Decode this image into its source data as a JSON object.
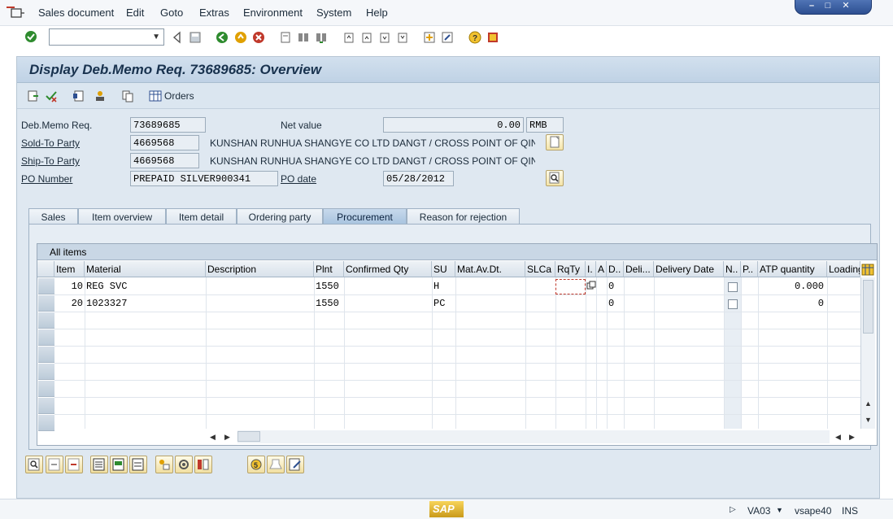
{
  "menubar": {
    "items": [
      "Sales document",
      "Edit",
      "Goto",
      "Extras",
      "Environment",
      "System",
      "Help"
    ]
  },
  "title": "Display Deb.Memo Req. 73689685: Overview",
  "app_toolbar": {
    "orders_label": "Orders"
  },
  "header": {
    "debmemo": {
      "label": "Deb.Memo Req.",
      "value": "73689685"
    },
    "net_value": {
      "label": "Net value",
      "value": "0.00",
      "currency": "RMB"
    },
    "sold_to": {
      "label": "Sold-To Party",
      "value": "4669568",
      "name": "KUNSHAN RUNHUA SHANGYE CO LTD DANGT / CROSS POINT OF QIN..."
    },
    "ship_to": {
      "label": "Ship-To Party",
      "value": "4669568",
      "name": "KUNSHAN RUNHUA SHANGYE CO LTD DANGT / CROSS POINT OF QIN..."
    },
    "po_number": {
      "label": "PO Number",
      "value": "PREPAID SILVER900341"
    },
    "po_date": {
      "label": "PO date",
      "value": "05/28/2012"
    }
  },
  "tabs": [
    "Sales",
    "Item overview",
    "Item detail",
    "Ordering party",
    "Procurement",
    "Reason for rejection"
  ],
  "active_tab": "Procurement",
  "grid": {
    "title": "All items",
    "columns": [
      "Item",
      "Material",
      "Description",
      "Plnt",
      "Confirmed Qty",
      "SU",
      "Mat.Av.Dt.",
      "SLCa",
      "RqTy",
      "I.",
      "A",
      "D..",
      "Deli...",
      "Delivery Date",
      "N..",
      "P..",
      "ATP quantity",
      "Loading..."
    ],
    "rows": [
      {
        "item": "10",
        "material": "REG SVC",
        "plnt": "1550",
        "su": "H",
        "d": "0",
        "atp": "0.000"
      },
      {
        "item": "20",
        "material": "1023327",
        "plnt": "1550",
        "su": "PC",
        "d": "0",
        "atp": "0"
      }
    ]
  },
  "statusbar": {
    "transaction": "VA03",
    "server": "vsape40",
    "mode": "INS",
    "logo": "SAP"
  },
  "colors": {
    "panel": "#dfe8f1",
    "title": "#18324e",
    "active_tab": "#a9c4df"
  }
}
